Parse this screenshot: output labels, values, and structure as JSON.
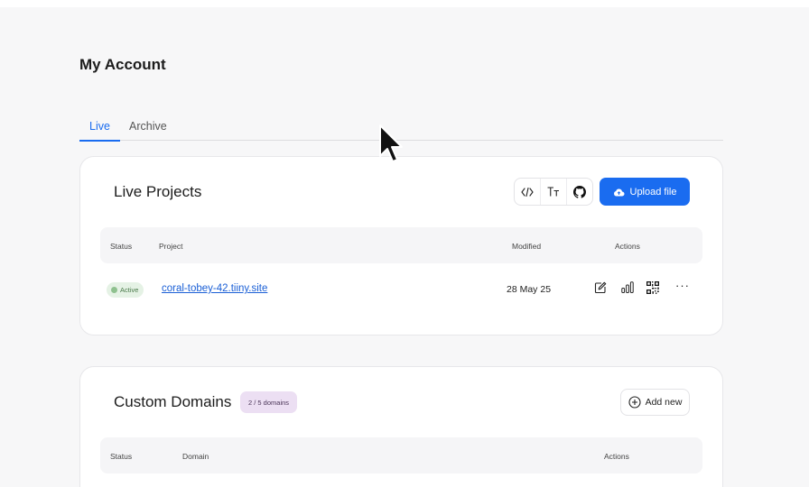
{
  "page": {
    "title": "My Account"
  },
  "tabs": [
    {
      "label": "Live",
      "active": true
    },
    {
      "label": "Archive",
      "active": false
    }
  ],
  "live_projects": {
    "title": "Live Projects",
    "tools": [
      {
        "icon": "code-icon",
        "glyph": "</>"
      },
      {
        "icon": "text-size-icon",
        "glyph": "Tт"
      },
      {
        "icon": "github-icon"
      }
    ],
    "upload_label": "Upload file",
    "columns": {
      "status": "Status",
      "project": "Project",
      "modified": "Modified",
      "actions": "Actions"
    },
    "rows": [
      {
        "status": "Active",
        "project": "coral-tobey-42.tiiny.site",
        "modified": "28 May 25",
        "actions": [
          "edit-icon",
          "analytics-icon",
          "qr-code-icon",
          "more-icon"
        ]
      }
    ]
  },
  "custom_domains": {
    "title": "Custom Domains",
    "badge": "2 / 5 domains",
    "add_label": "Add new",
    "columns": {
      "status": "Status",
      "domain": "Domain",
      "actions": "Actions"
    }
  },
  "colors": {
    "accent": "#1a6cf0",
    "active_badge_bg": "#e5f2e5",
    "domains_badge_bg": "#ecdff3"
  }
}
